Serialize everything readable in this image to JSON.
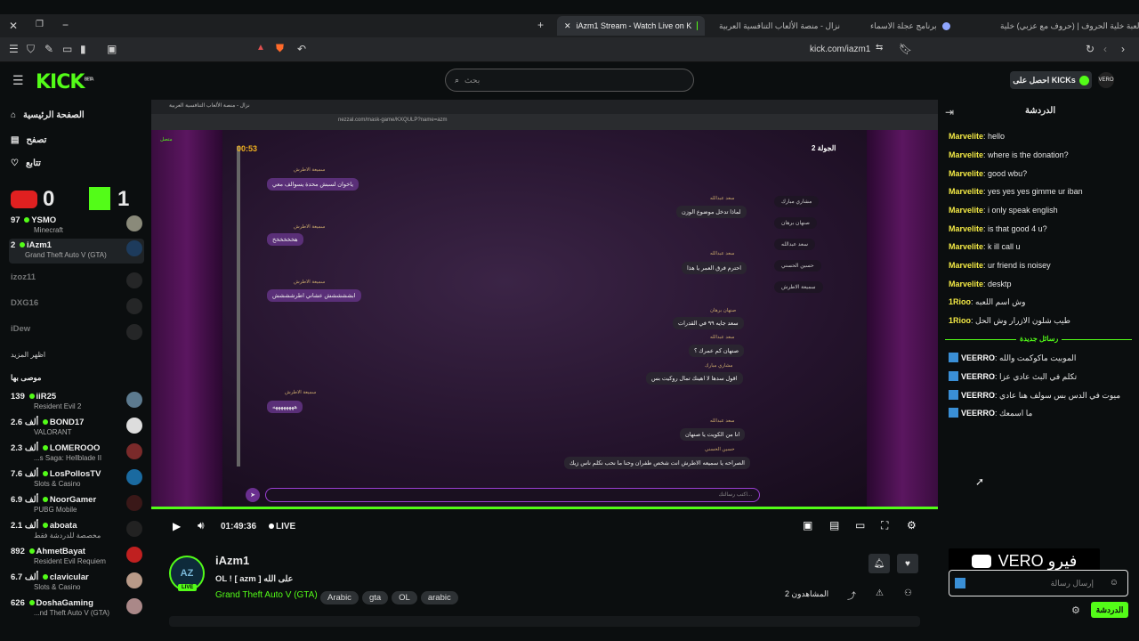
{
  "tabs": [
    {
      "label": "iAzm1 Stream - Watch Live on K"
    },
    {
      "label": "نزال - منصة الألعاب التنافسية العربية"
    },
    {
      "label": "برنامج عجلة الاسماء"
    },
    {
      "label": "لعبة خلية الحروف | (حروف مع عزبي) خلية"
    }
  ],
  "address": "kick.com/iazm1",
  "header": {
    "search_placeholder": "بحث",
    "kicks_label": "احصل على KICKs"
  },
  "sidebar": {
    "nav": [
      "الصفحة الرئيسية",
      "تصفح",
      "تتابع"
    ],
    "score": {
      "left": "0",
      "right": "1"
    },
    "following": [
      {
        "count": "97",
        "name": "YSMO",
        "category": "Minecraft",
        "live": true
      },
      {
        "count": "2",
        "name": "iAzm1",
        "category": "Grand Theft Auto V (GTA)",
        "live": true
      },
      {
        "name": "izoz11",
        "live": false
      },
      {
        "name": "DXG16",
        "live": false
      },
      {
        "name": "iDew",
        "live": false
      }
    ],
    "show_more": "اظهر المزيد",
    "recommended_title": "موصى بها",
    "recommended": [
      {
        "count": "139",
        "name": "iiR25",
        "category": "Resident Evil 2"
      },
      {
        "count": "2.6 ألف",
        "name": "BOND17",
        "category": "VALORANT"
      },
      {
        "count": "2.3 ألف",
        "name": "LOMEROOO",
        "category": "...s Saga: Hellblade II"
      },
      {
        "count": "7.6 ألف",
        "name": "LosPollosTV",
        "category": "Slots & Casino"
      },
      {
        "count": "6.9 ألف",
        "name": "NoorGamer",
        "category": "PUBG Mobile"
      },
      {
        "count": "2.1 ألف",
        "name": "aboata",
        "category": "مخصصة للدردشة فقط"
      },
      {
        "count": "892",
        "name": "AhmetBayat",
        "category": "Resident Evil Requiem"
      },
      {
        "count": "6.7 ألف",
        "name": "clavicular",
        "category": "Slots & Casino"
      },
      {
        "count": "626",
        "name": "DoshaGaming",
        "category": "...nd Theft Auto V (GTA)"
      }
    ]
  },
  "video": {
    "inner_tab": "نزال - منصة الألعاب التنافسية العربية",
    "inner_url": "nezzal.com/mask-game/KXQULP?name=azm",
    "timer": "00:53",
    "round": "الجولة 2",
    "status": "متصل",
    "players": [
      "مشاري مبارك",
      "صنهان برهان",
      "سعد عبدالله",
      "حسين الحسني",
      "سميعة الاطرش"
    ],
    "messages": [
      {
        "name": "سميعة الاطرش",
        "text": "ياخوان لسبش محدة يسوالف معي",
        "side": "l"
      },
      {
        "name": "سعد عبدالله",
        "text": "لماذا تدخل موضوع الوزن",
        "side": "r"
      },
      {
        "name": "سميعة الاطرش",
        "text": "هخخخخخخ",
        "side": "l"
      },
      {
        "name": "سعد عبدالله",
        "text": "احترم فرق العمر يا هذا",
        "side": "r"
      },
      {
        "name": "سميعة الاطرش",
        "text": "ابششششش عشاني اطرشششش",
        "side": "l"
      },
      {
        "name": "صنهان برهان",
        "text": "سعد جايه ٩٩ في القدرات",
        "side": "r"
      },
      {
        "name": "سعد عبدالله",
        "text": "صنهان كم عمرك ؟",
        "side": "r"
      },
      {
        "name": "مشاري مبارك",
        "text": "اقول سدها لا اهينك تمال روكيت بس",
        "side": "r"
      },
      {
        "name": "سميعة الاطرش",
        "text": "ههههههههه",
        "side": "l"
      },
      {
        "name": "سعد عبدالله",
        "text": "انا من الكويت يا صنهان",
        "side": "r"
      },
      {
        "name": "حسين الحسني",
        "text": "الصراحه يا سميعه الاطرش انت شخص طفران وحنا ما نحب نكلم ناس زيك",
        "side": "r"
      }
    ],
    "input_placeholder": "اكتب رسالتك..."
  },
  "controls": {
    "time": "01:49:36",
    "live": "LIVE"
  },
  "stream": {
    "channel": "iAzm1",
    "title": "OL ! [ azm ] على الله",
    "category": "Grand Theft Auto V (GTA)",
    "tags": [
      "Arabic",
      "gta",
      "OL",
      "arabic"
    ],
    "viewers": "2 المشاهدون",
    "live_badge": "LIVE"
  },
  "chat": {
    "title": "الدردشة",
    "messages": [
      {
        "user": "Marvelite",
        "text": "hello"
      },
      {
        "user": "Marvelite",
        "text": "where is the donation?"
      },
      {
        "user": "Marvelite",
        "text": "good wbu?"
      },
      {
        "user": "Marvelite",
        "text": "yes yes yes gimme ur iban"
      },
      {
        "user": "Marvelite",
        "text": "i only speak english"
      },
      {
        "user": "Marvelite",
        "text": "is that good 4 u?"
      },
      {
        "user": "Marvelite",
        "text": "k ill call u"
      },
      {
        "user": "Marvelite",
        "text": "ur friend is noisey"
      },
      {
        "user": "Marvelite",
        "text": "desktp"
      },
      {
        "user": "1Rioo",
        "text": "وش اسم اللعبه"
      },
      {
        "user": "1Rioo",
        "text": "طيب شلون الازرار وش الحل"
      }
    ],
    "new_messages": "رسائل جديدة",
    "new": [
      {
        "user": "VEERRO",
        "text": "الموبيت ماكوكمت والله"
      },
      {
        "user": "VEERRO",
        "text": "تكلم في البث عادي عزا"
      },
      {
        "user": "VEERRO",
        "text": "ميوت في الدس بس سولف هنا عادي"
      },
      {
        "user": "VEERRO",
        "text": "ما اسمعك"
      }
    ],
    "input_placeholder": "إرسال رسالة",
    "send_label": "الدردشة",
    "overlay_text": "VERO فيرو"
  },
  "colors": {
    "accent": "#53fc18",
    "username": "#f4ea45",
    "chat_bubble": "#5a2f78"
  }
}
